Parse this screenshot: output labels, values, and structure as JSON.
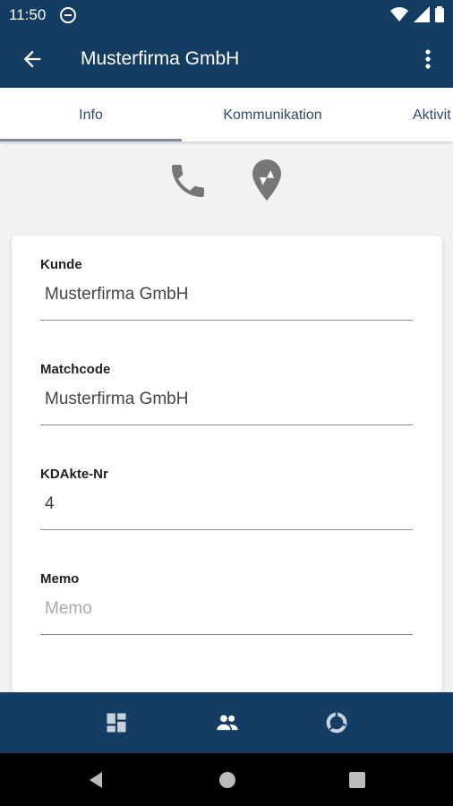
{
  "status_bar": {
    "time": "11:50"
  },
  "app_bar": {
    "title": "Musterfirma GmbH"
  },
  "tabs": [
    {
      "label": "Info",
      "active": true
    },
    {
      "label": "Kommunikation",
      "active": false
    },
    {
      "label": "Aktivit",
      "active": false
    }
  ],
  "quick_actions": [
    "phone-icon",
    "place-icon"
  ],
  "form": {
    "kunde": {
      "label": "Kunde",
      "value": "Musterfirma GmbH"
    },
    "matchcode": {
      "label": "Matchcode",
      "value": "Musterfirma GmbH"
    },
    "kdakte": {
      "label": "KDAkte-Nr",
      "value": "4"
    },
    "memo": {
      "label": "Memo",
      "placeholder": "Memo"
    }
  },
  "bottom_nav": [
    "dashboard-icon",
    "people-icon",
    "donut-icon"
  ],
  "colors": {
    "primary": "#143d63",
    "background": "#f2f2f2",
    "icon_gray": "#777777"
  }
}
